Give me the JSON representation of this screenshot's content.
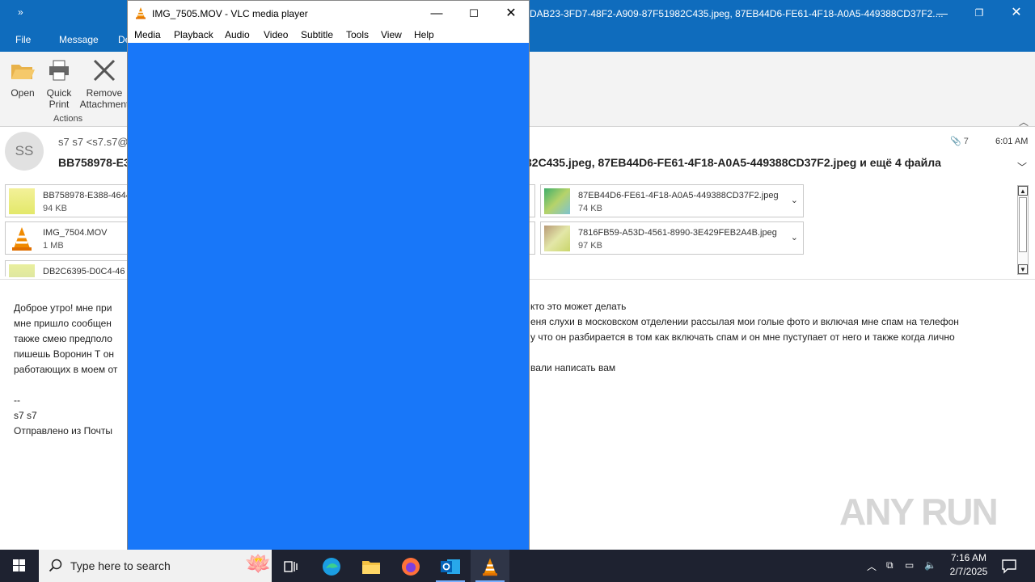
{
  "outlook": {
    "title_text": "DAB23-3FD7-48F2-A909-87F51982C435.jpeg, 87EB44D6-FE61-4F18-A0A5-449388CD37F2....",
    "menu": [
      "File",
      "Message",
      "De"
    ],
    "ribbon": {
      "open": "Open",
      "quick_print_1": "Quick",
      "quick_print_2": "Print",
      "remove_1": "Remove",
      "remove_2": "Attachment",
      "group": "Actions"
    },
    "header": {
      "avatar": "SS",
      "sender": "s7 s7 <s7.s7@",
      "subject_left": "BB758978-E3",
      "subject_right": "32C435.jpeg, 87EB44D6-FE61-4F18-A0A5-449388CD37F2.jpeg и ещё 4 файла",
      "attachment_count": "7",
      "time": "6:01 AM"
    },
    "attachments": [
      {
        "name": "BB758978-E388-4644",
        "size": "94 KB"
      },
      {
        "name": "IMG_7504.MOV",
        "size": "1 MB"
      },
      {
        "name": "DB2C6395-D0C4-46",
        "size": ""
      },
      {
        "name": "87EB44D6-FE61-4F18-A0A5-449388CD37F2.jpeg",
        "size": "74 KB"
      },
      {
        "name": "7816FB59-A53D-4561-8990-3E429FEB2A4B.jpeg",
        "size": "97 KB"
      }
    ],
    "body_left": [
      "Доброе утро! мне при",
      "мне пришло сообщен",
      "также смею предполо",
      "пишешь Воронин Т он",
      "работающих в моем от",
      "",
      "--",
      "s7 s7",
      "Отправлено из Почты"
    ],
    "body_right": [
      "кто это может делать",
      "еня слухи в  московском отделении рассылая мои голые фото и включая мне спам на телефон",
      "у что он разбирается в том как включать спам и он мне пуступает от него и также когда лично",
      "",
      "вали написать вам"
    ]
  },
  "vlc": {
    "title": "IMG_7505.MOV - VLC media player",
    "menu": [
      "Media",
      "Playback",
      "Audio",
      "Video",
      "Subtitle",
      "Tools",
      "View",
      "Help"
    ],
    "video_color": "#1877f9"
  },
  "taskbar": {
    "search_placeholder": "Type here to search",
    "time": "7:16 AM",
    "date": "2/7/2025"
  },
  "watermark": "ANY RUN"
}
